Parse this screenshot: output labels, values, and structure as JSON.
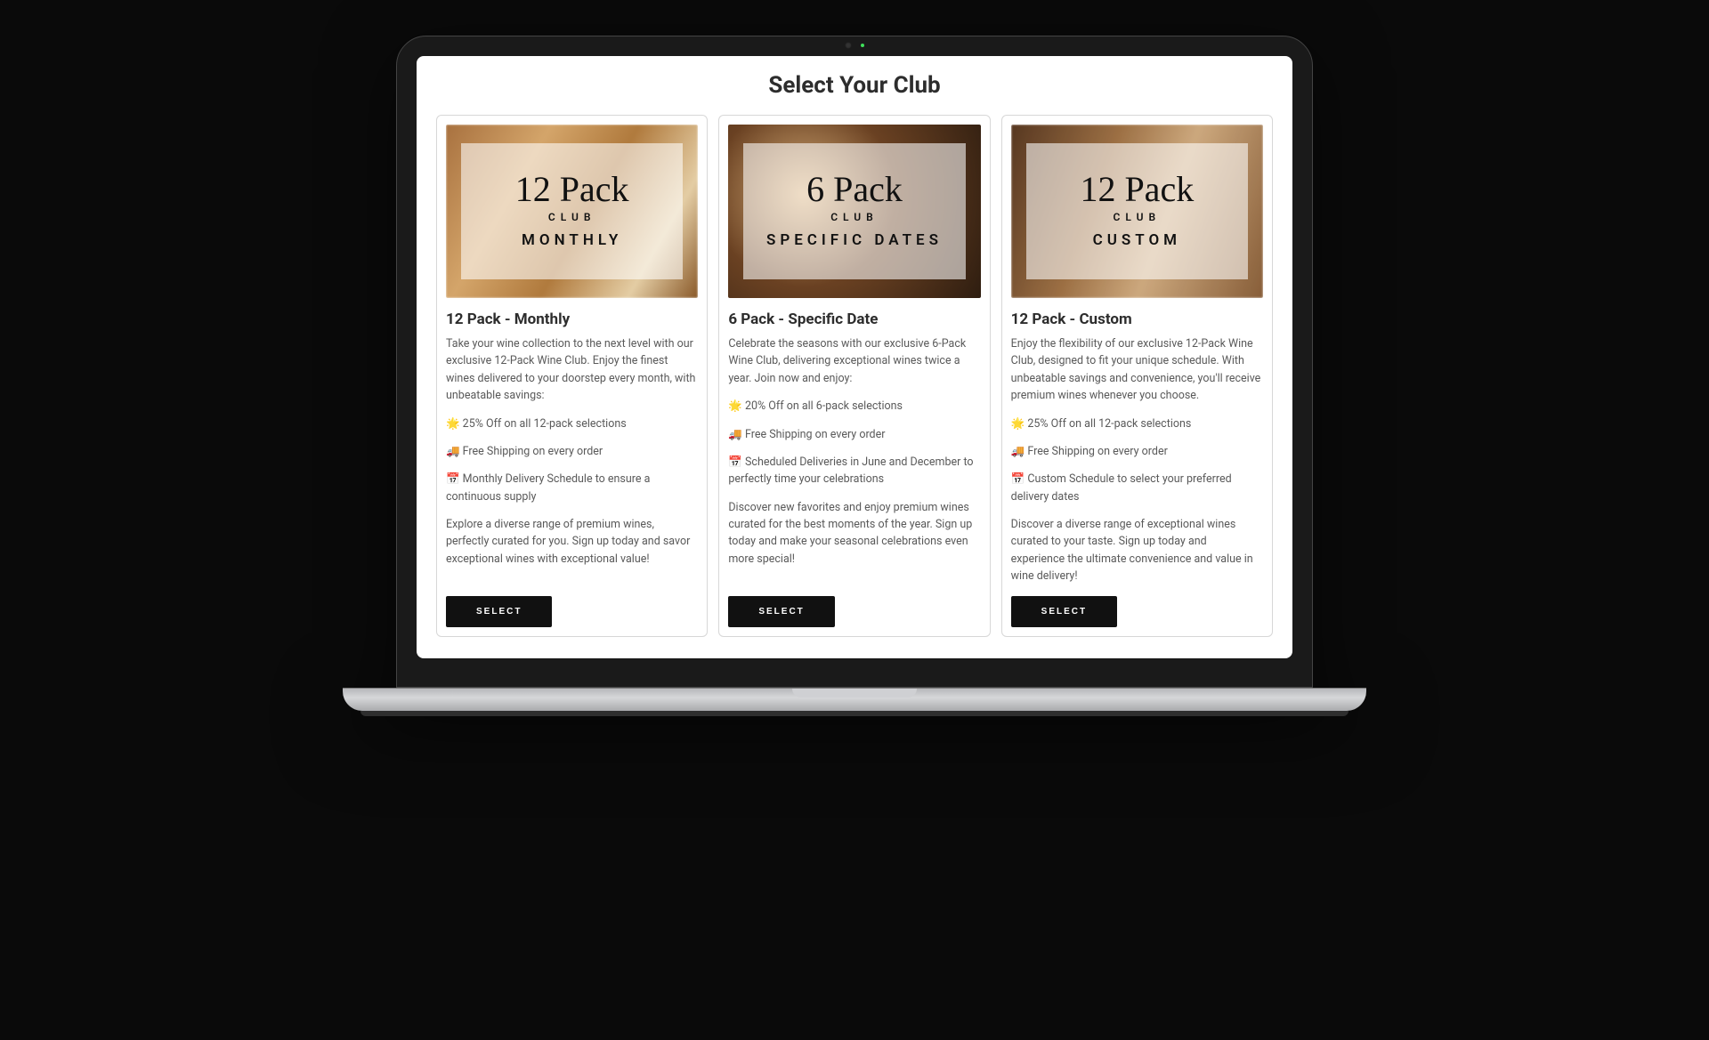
{
  "page_title": "Select Your Club",
  "select_label": "SELECT",
  "hero_sub": "CLUB",
  "clubs": [
    {
      "hero_script": "12 Pack",
      "hero_tag": "MONTHLY",
      "title": "12 Pack - Monthly",
      "intro": "Take your wine collection to the next level with our exclusive 12-Pack Wine Club. Enjoy the finest wines delivered to your doorstep every month, with unbeatable savings:",
      "b1": "🌟 25% Off on all 12-pack selections",
      "b2": "🚚 Free Shipping on every order",
      "b3": "📅 Monthly Delivery Schedule to ensure a continuous supply",
      "outro": "Explore a diverse range of premium wines, perfectly curated for you. Sign up today and savor exceptional wines with exceptional value!"
    },
    {
      "hero_script": "6 Pack",
      "hero_tag": "SPECIFIC DATES",
      "title": "6 Pack - Specific Date",
      "intro": "Celebrate the seasons with our exclusive 6-Pack Wine Club, delivering exceptional wines twice a year. Join now and enjoy:",
      "b1": "🌟 20% Off on all 6-pack selections",
      "b2": "🚚 Free Shipping on every order",
      "b3": "📅 Scheduled Deliveries in June and December to perfectly time your celebrations",
      "outro": "Discover new favorites and enjoy premium wines curated for the best moments of the year. Sign up today and make your seasonal celebrations even more special!"
    },
    {
      "hero_script": "12 Pack",
      "hero_tag": "CUSTOM",
      "title": "12 Pack - Custom",
      "intro": "Enjoy the flexibility of our exclusive 12-Pack Wine Club, designed to fit your unique schedule. With unbeatable savings and convenience, you'll receive premium wines whenever you choose.",
      "b1": "🌟 25% Off on all 12-pack selections",
      "b2": "🚚 Free Shipping on every order",
      "b3": "📅 Custom Schedule to select your preferred delivery dates",
      "outro": "Discover a diverse range of exceptional wines curated to your taste. Sign up today and experience the ultimate convenience and value in wine delivery!"
    }
  ]
}
